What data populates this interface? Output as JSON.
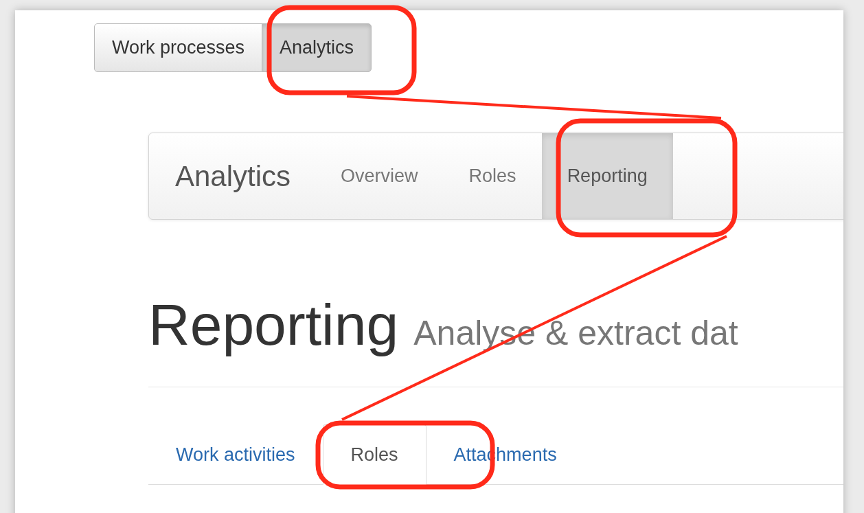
{
  "button_group": [
    {
      "label": "Work processes",
      "selected": false
    },
    {
      "label": "Analytics",
      "selected": true
    }
  ],
  "navbar": {
    "brand": "Analytics",
    "links": [
      {
        "label": "Overview",
        "selected": false
      },
      {
        "label": "Roles",
        "selected": false
      },
      {
        "label": "Reporting",
        "selected": true
      }
    ]
  },
  "page_header": {
    "title": "Reporting",
    "subtitle": "Analyse & extract dat"
  },
  "tabs": [
    {
      "label": "Work activities",
      "selected": false
    },
    {
      "label": "Roles",
      "selected": true
    },
    {
      "label": "Attachments",
      "selected": false
    }
  ]
}
